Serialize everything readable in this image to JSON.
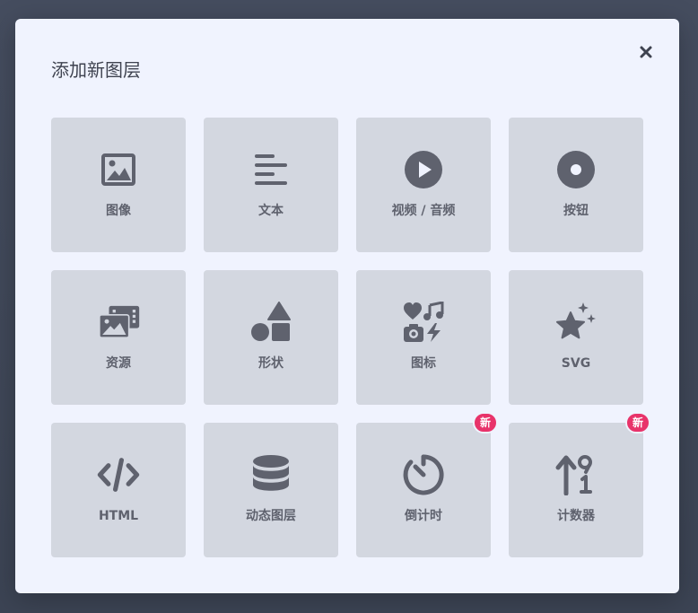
{
  "modal": {
    "title": "添加新图层",
    "close_icon": "close-icon"
  },
  "colors": {
    "tile_bg": "#d3d7e0",
    "icon": "#5f626e",
    "badge": "#e8336a",
    "modal_bg": "#f0f3fe"
  },
  "tiles": [
    {
      "label": "图像",
      "icon": "image-icon"
    },
    {
      "label": "文本",
      "icon": "text-align-icon"
    },
    {
      "label": "视频 / 音频",
      "icon": "play-circle-icon"
    },
    {
      "label": "按钮",
      "icon": "record-button-icon"
    },
    {
      "label": "资源",
      "icon": "media-assets-icon"
    },
    {
      "label": "形状",
      "icon": "shapes-icon"
    },
    {
      "label": "图标",
      "icon": "icon-set-icon"
    },
    {
      "label": "SVG",
      "icon": "sparkle-star-icon"
    },
    {
      "label": "HTML",
      "icon": "code-icon"
    },
    {
      "label": "动态图层",
      "icon": "database-icon"
    },
    {
      "label": "倒计时",
      "icon": "timer-icon",
      "badge": "新"
    },
    {
      "label": "计数器",
      "icon": "counter-icon",
      "badge": "新"
    }
  ]
}
